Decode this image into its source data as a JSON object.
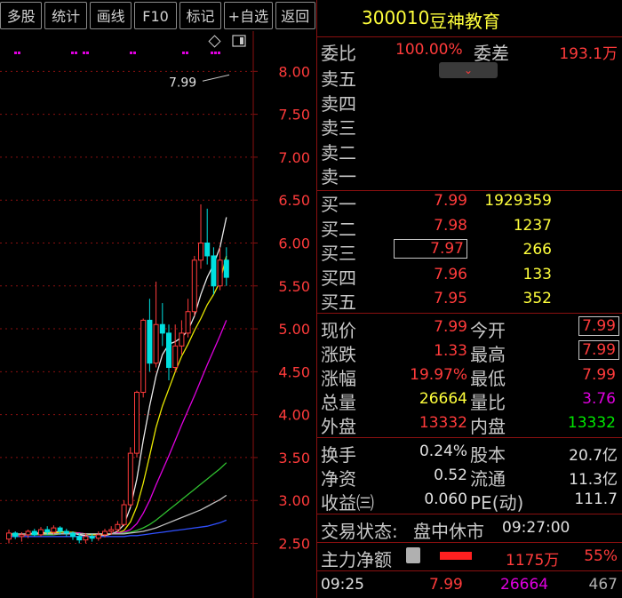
{
  "toolbar": {
    "buttons": [
      "多股",
      "统计",
      "画线",
      "F10",
      "标记",
      "+自选",
      "返回"
    ]
  },
  "chart_data": {
    "type": "candlestick",
    "price_axis_labels": [
      "8.00",
      "7.50",
      "7.00",
      "6.50",
      "6.00",
      "5.50",
      "5.00",
      "4.50",
      "4.00",
      "3.50",
      "3.00",
      "2.50"
    ],
    "ylim": [
      2.35,
      8.2
    ],
    "high_marker_label": "7.99",
    "candles": [
      {
        "o": 2.55,
        "c": 2.62,
        "h": 2.66,
        "l": 2.5
      },
      {
        "o": 2.62,
        "c": 2.58,
        "h": 2.64,
        "l": 2.55
      },
      {
        "o": 2.58,
        "c": 2.6,
        "h": 2.63,
        "l": 2.52
      },
      {
        "o": 2.6,
        "c": 2.64,
        "h": 2.66,
        "l": 2.56
      },
      {
        "o": 2.64,
        "c": 2.6,
        "h": 2.67,
        "l": 2.58
      },
      {
        "o": 2.6,
        "c": 2.66,
        "h": 2.69,
        "l": 2.58
      },
      {
        "o": 2.66,
        "c": 2.63,
        "h": 2.7,
        "l": 2.6
      },
      {
        "o": 2.63,
        "c": 2.68,
        "h": 2.71,
        "l": 2.6
      },
      {
        "o": 2.68,
        "c": 2.64,
        "h": 2.7,
        "l": 2.6
      },
      {
        "o": 2.64,
        "c": 2.62,
        "h": 2.67,
        "l": 2.58
      },
      {
        "o": 2.62,
        "c": 2.58,
        "h": 2.64,
        "l": 2.54
      },
      {
        "o": 2.58,
        "c": 2.54,
        "h": 2.62,
        "l": 2.5
      },
      {
        "o": 2.54,
        "c": 2.58,
        "h": 2.62,
        "l": 2.5
      },
      {
        "o": 2.58,
        "c": 2.56,
        "h": 2.61,
        "l": 2.52
      },
      {
        "o": 2.56,
        "c": 2.6,
        "h": 2.64,
        "l": 2.53
      },
      {
        "o": 2.6,
        "c": 2.64,
        "h": 2.67,
        "l": 2.57
      },
      {
        "o": 2.64,
        "c": 2.66,
        "h": 2.7,
        "l": 2.6
      },
      {
        "o": 2.66,
        "c": 2.72,
        "h": 2.76,
        "l": 2.63
      },
      {
        "o": 2.72,
        "c": 2.95,
        "h": 3.0,
        "l": 2.7
      },
      {
        "o": 2.95,
        "c": 3.55,
        "h": 3.62,
        "l": 2.92
      },
      {
        "o": 3.55,
        "c": 4.26,
        "h": 4.28,
        "l": 3.5
      },
      {
        "o": 4.26,
        "c": 5.1,
        "h": 5.12,
        "l": 4.2
      },
      {
        "o": 5.1,
        "c": 4.6,
        "h": 5.35,
        "l": 4.5
      },
      {
        "o": 4.6,
        "c": 5.05,
        "h": 5.55,
        "l": 4.55
      },
      {
        "o": 5.05,
        "c": 4.95,
        "h": 5.3,
        "l": 4.8
      },
      {
        "o": 4.95,
        "c": 4.55,
        "h": 5.05,
        "l": 4.4
      },
      {
        "o": 4.55,
        "c": 4.8,
        "h": 5.05,
        "l": 4.5
      },
      {
        "o": 4.8,
        "c": 4.95,
        "h": 5.1,
        "l": 4.7
      },
      {
        "o": 4.95,
        "c": 5.2,
        "h": 5.35,
        "l": 4.9
      },
      {
        "o": 5.2,
        "c": 5.8,
        "h": 5.85,
        "l": 5.15
      },
      {
        "o": 5.8,
        "c": 6.0,
        "h": 6.45,
        "l": 5.7
      },
      {
        "o": 6.0,
        "c": 5.85,
        "h": 6.4,
        "l": 5.75
      },
      {
        "o": 5.85,
        "c": 5.5,
        "h": 5.95,
        "l": 5.4
      },
      {
        "o": 5.5,
        "c": 5.8,
        "h": 5.95,
        "l": 5.45
      },
      {
        "o": 5.8,
        "c": 5.6,
        "h": 5.95,
        "l": 5.5
      }
    ],
    "ma_lines": [
      {
        "color": "#e8e8e8",
        "values": [
          2.6,
          2.61,
          2.6,
          2.61,
          2.62,
          2.62,
          2.63,
          2.63,
          2.64,
          2.63,
          2.62,
          2.6,
          2.59,
          2.58,
          2.58,
          2.59,
          2.61,
          2.64,
          2.72,
          2.92,
          3.25,
          3.7,
          4.1,
          4.45,
          4.7,
          4.82,
          4.85,
          4.9,
          4.98,
          5.15,
          5.4,
          5.6,
          5.75,
          5.95,
          6.3
        ]
      },
      {
        "color": "#e8e800",
        "values": [
          2.59,
          2.6,
          2.6,
          2.6,
          2.61,
          2.61,
          2.62,
          2.62,
          2.63,
          2.63,
          2.63,
          2.62,
          2.61,
          2.6,
          2.6,
          2.6,
          2.61,
          2.62,
          2.65,
          2.75,
          2.93,
          3.2,
          3.52,
          3.85,
          4.1,
          4.3,
          4.5,
          4.68,
          4.82,
          4.98,
          5.12,
          5.28,
          5.4,
          5.55,
          5.85
        ]
      },
      {
        "color": "#e000e0",
        "values": [
          2.58,
          2.59,
          2.59,
          2.6,
          2.6,
          2.6,
          2.61,
          2.61,
          2.61,
          2.62,
          2.62,
          2.62,
          2.61,
          2.61,
          2.61,
          2.61,
          2.61,
          2.62,
          2.63,
          2.66,
          2.73,
          2.85,
          3.0,
          3.18,
          3.35,
          3.52,
          3.7,
          3.88,
          4.05,
          4.22,
          4.4,
          4.58,
          4.75,
          4.92,
          5.1
        ]
      },
      {
        "color": "#30c030",
        "values": [
          2.6,
          2.6,
          2.6,
          2.6,
          2.6,
          2.6,
          2.6,
          2.6,
          2.61,
          2.61,
          2.61,
          2.61,
          2.61,
          2.61,
          2.61,
          2.61,
          2.61,
          2.61,
          2.62,
          2.63,
          2.65,
          2.68,
          2.72,
          2.77,
          2.83,
          2.89,
          2.95,
          3.01,
          3.07,
          3.13,
          3.19,
          3.25,
          3.31,
          3.37,
          3.44
        ]
      },
      {
        "color": "#c0c0c0",
        "values": [
          2.61,
          2.61,
          2.61,
          2.61,
          2.61,
          2.61,
          2.61,
          2.61,
          2.61,
          2.61,
          2.61,
          2.61,
          2.61,
          2.61,
          2.61,
          2.61,
          2.61,
          2.61,
          2.61,
          2.62,
          2.63,
          2.64,
          2.66,
          2.68,
          2.71,
          2.74,
          2.77,
          2.8,
          2.83,
          2.86,
          2.89,
          2.93,
          2.97,
          3.01,
          3.06
        ]
      },
      {
        "color": "#3050ff",
        "values": [
          2.58,
          2.58,
          2.58,
          2.58,
          2.58,
          2.58,
          2.58,
          2.58,
          2.58,
          2.58,
          2.58,
          2.58,
          2.58,
          2.58,
          2.58,
          2.58,
          2.58,
          2.58,
          2.58,
          2.59,
          2.59,
          2.6,
          2.61,
          2.62,
          2.63,
          2.64,
          2.65,
          2.66,
          2.67,
          2.68,
          2.69,
          2.7,
          2.72,
          2.74,
          2.77
        ]
      }
    ]
  },
  "stock": {
    "code": "300010",
    "name": "豆神教育"
  },
  "order_ratio": {
    "wei_bi_label": "委比",
    "wei_bi": "100.00%",
    "wei_cha_label": "委差",
    "wei_cha": "193.1万"
  },
  "sell_levels": [
    {
      "label": "卖五",
      "price": "",
      "vol": ""
    },
    {
      "label": "卖四",
      "price": "",
      "vol": ""
    },
    {
      "label": "卖三",
      "price": "",
      "vol": ""
    },
    {
      "label": "卖二",
      "price": "",
      "vol": ""
    },
    {
      "label": "卖一",
      "price": "",
      "vol": ""
    }
  ],
  "buy_levels": [
    {
      "label": "买一",
      "price": "7.99",
      "vol": "1929359"
    },
    {
      "label": "买二",
      "price": "7.98",
      "vol": "1237"
    },
    {
      "label": "买三",
      "price": "7.97",
      "vol": "266"
    },
    {
      "label": "买四",
      "price": "7.96",
      "vol": "133"
    },
    {
      "label": "买五",
      "price": "7.95",
      "vol": "352"
    }
  ],
  "quote": {
    "xianjia_label": "现价",
    "xianjia": "7.99",
    "jinkai_label": "今开",
    "jinkai": "7.99",
    "zhangdie_label": "涨跌",
    "zhangdie": "1.33",
    "zuigao_label": "最高",
    "zuigao": "7.99",
    "zhangfu_label": "涨幅",
    "zhangfu": "19.97%",
    "zuidi_label": "最低",
    "zuidi": "7.99",
    "zongliang_label": "总量",
    "zongliang": "26664",
    "liangbi_label": "量比",
    "liangbi": "3.76",
    "waipan_label": "外盘",
    "waipan": "13332",
    "neipan_label": "内盘",
    "neipan": "13332"
  },
  "fundamentals": {
    "huanshou_label": "换手",
    "huanshou": "0.24%",
    "guben_label": "股本",
    "guben": "20.7亿",
    "jingzi_label": "净资",
    "jingzi": "0.52",
    "liutong_label": "流通",
    "liutong": "11.3亿",
    "shouyi_label": "收益㈢",
    "shouyi": "0.060",
    "pe_label": "PE(动)",
    "pe": "111.7"
  },
  "status": {
    "label": "交易状态:",
    "value": "盘中休市",
    "time": "09:27:00"
  },
  "main_flow": {
    "label": "主力净额",
    "amount": "1175万",
    "pct": "55%"
  },
  "last_tick": {
    "time": "09:25",
    "price": "7.99",
    "vol": "26664",
    "count": "467"
  },
  "colors": {
    "up": "#ff3b3b",
    "down": "#00e0e0",
    "grid": "#8a1010",
    "axis_text": "#ff3b3b"
  }
}
